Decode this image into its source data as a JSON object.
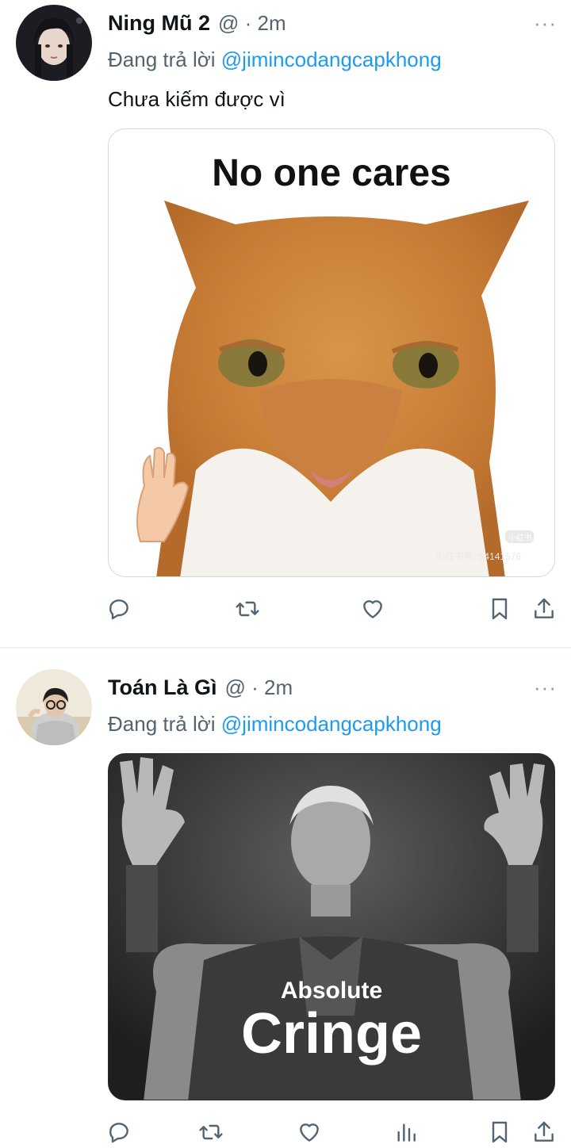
{
  "tweets": [
    {
      "display_name": "Ning Mũ 2",
      "handle_sep": "@ · 2m",
      "more": "···",
      "reply_prefix": "Đang trả lời ",
      "reply_handle": "@jimincodangcapkhong",
      "text": "Chưa kiếm được vì",
      "media_caption": "No one cares",
      "watermark": "小红书号: 54141576",
      "watermark_badge": "小红书"
    },
    {
      "display_name": "Toán Là Gì",
      "handle_sep": "@ · 2m",
      "more": "···",
      "reply_prefix": "Đang trả lời ",
      "reply_handle": "@jimincodangcapkhong",
      "media_caption_small": "Absolute",
      "media_caption_big": "Cringe"
    }
  ],
  "icons": [
    "reply-icon",
    "retweet-icon",
    "like-icon",
    "views-icon",
    "bookmark-icon",
    "share-icon"
  ],
  "colors": {
    "link": "#1d9bf0",
    "secondary": "#536471",
    "icon": "#536471",
    "divider": "#eff3f4"
  }
}
